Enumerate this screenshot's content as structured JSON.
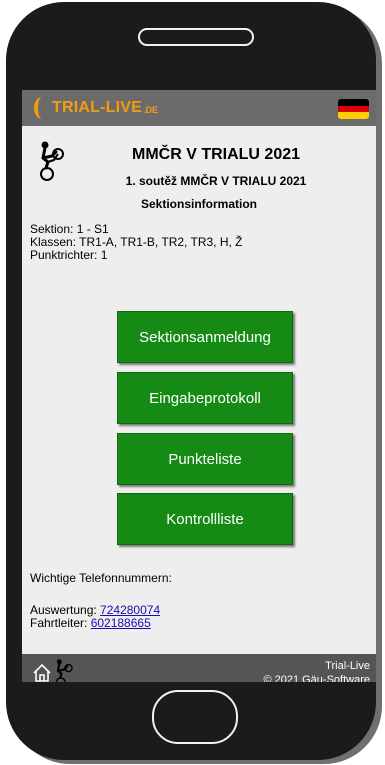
{
  "header": {
    "logo_text": "TRIAL-LIVE",
    "logo_tld": ".DE",
    "language": "German"
  },
  "event": {
    "title": "MMČR V TRIALU 2021",
    "subtitle": "1. soutěž MMČR V TRIALU 2021",
    "page_title": "Sektionsinformation"
  },
  "info": {
    "section": "Sektion: 1 - S1",
    "classes": "Klassen: TR1-A, TR1-B, TR2, TR3, H, Ž",
    "judges": "Punktrichter: 1"
  },
  "buttons": {
    "register": "Sektionsanmeldung",
    "input_protocol": "Eingabeprotokoll",
    "points_list": "Punkteliste",
    "control_list": "Kontrollliste"
  },
  "contacts": {
    "heading": "Wichtige Telefonnummern:",
    "evaluation_label": "Auswertung: ",
    "evaluation_phone": "724280074",
    "director_label": "Fahrtleiter: ",
    "director_phone": "602188665"
  },
  "footer": {
    "brand": "Trial-Live",
    "copyright": "© 2021 Gäu-Software"
  },
  "colors": {
    "accent_orange": "#f39c12",
    "button_green": "#158a15",
    "topbar": "#6b6b6b",
    "footer": "#555555"
  }
}
